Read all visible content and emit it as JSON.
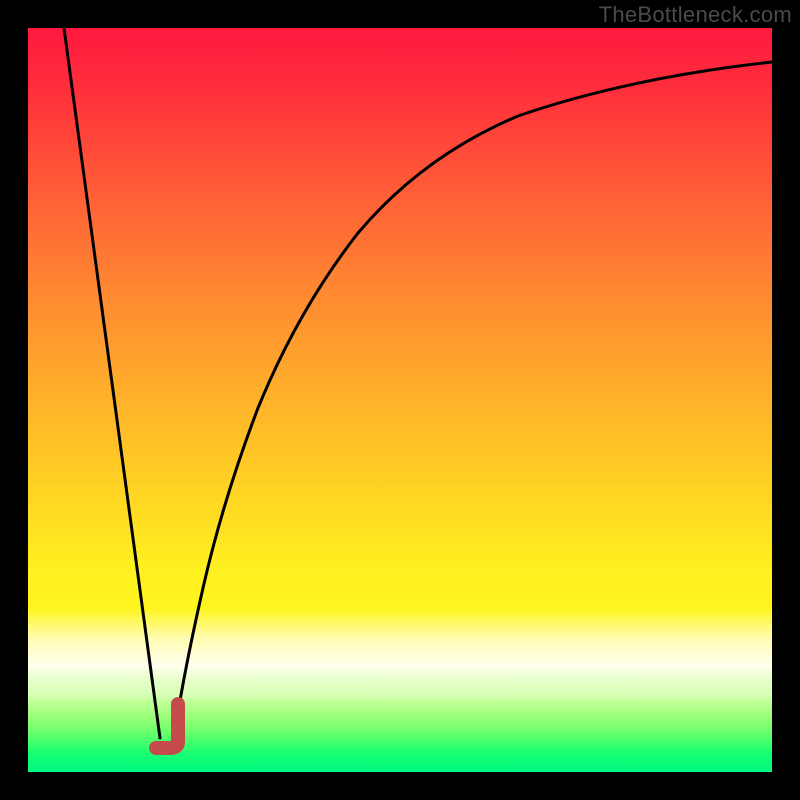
{
  "watermark": "TheBottleneck.com",
  "colors": {
    "frame": "#000000",
    "gradient_top": "#ff193e",
    "gradient_bottom": "#00f780",
    "curve_stroke": "#000000",
    "marker_stroke": "#c54b4b",
    "watermark_text": "#4a4a4a"
  },
  "chart_data": {
    "type": "line",
    "title": "",
    "xlabel": "",
    "ylabel": "",
    "xlim": [
      0,
      100
    ],
    "ylim": [
      0,
      100
    ],
    "series": [
      {
        "name": "descending-line",
        "x": [
          5,
          18
        ],
        "y": [
          100,
          4.6
        ]
      },
      {
        "name": "ascending-curve",
        "x": [
          20,
          24,
          27,
          31,
          37,
          45,
          52,
          60,
          68,
          78,
          88,
          100
        ],
        "y": [
          4.6,
          25,
          37,
          49,
          62,
          72,
          80,
          85,
          89,
          92,
          94,
          95
        ]
      }
    ],
    "marker": {
      "name": "J-marker",
      "approx_x": 19,
      "approx_y": 4,
      "shape": "J"
    },
    "background": "vertical rainbow gradient red→yellow→green",
    "grid": false,
    "legend": false
  }
}
